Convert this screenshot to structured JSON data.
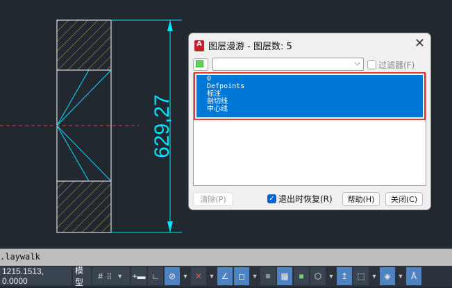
{
  "drawing": {
    "dimension": "629,27",
    "colors": {
      "hatch": "#c8a43a",
      "dim": "#00e5ff",
      "center": "#e53935",
      "outline": "#ffffff"
    }
  },
  "dialog": {
    "title": "图层漫游 - 图层数: 5",
    "filter_value": "",
    "filter_checkbox": "过滤器(F)",
    "filter_checked": false,
    "layers": [
      "0",
      "Defpoints",
      "标注",
      "剖切线",
      "中心线"
    ],
    "clear_button": "清除(P)",
    "restore_checkbox": "退出时恢复(R)",
    "restore_checked": true,
    "help_button": "帮助(H)",
    "close_button": "关闭(C)"
  },
  "command_line": ".laywalk",
  "status": {
    "coords": "1215.1513, 0.0000",
    "model": "模型"
  }
}
